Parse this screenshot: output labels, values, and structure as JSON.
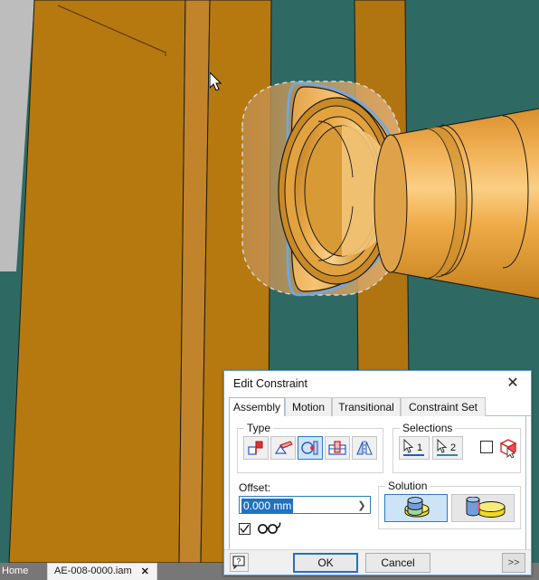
{
  "app": {
    "viewport": {
      "background_color": "#2e6a63",
      "part_color": "#b5790f",
      "shaft_color": "#e8a33a",
      "highlight_color": "#6fa8e8",
      "edge_color": "#1a1a1a",
      "cursor_name": "arrow-cursor"
    }
  },
  "taskbar": {
    "home_label": "Home",
    "document_tab": "AE-008-0000.iam",
    "close_glyph": "✕"
  },
  "dialog": {
    "title": "Edit Constraint",
    "close_glyph": "✕",
    "tabs": [
      {
        "label": "Assembly",
        "active": true
      },
      {
        "label": "Motion",
        "active": false
      },
      {
        "label": "Transitional",
        "active": false
      },
      {
        "label": "Constraint Set",
        "active": false
      }
    ],
    "type_group": {
      "label": "Type",
      "buttons": [
        {
          "name": "mate-constraint-icon",
          "selected": false
        },
        {
          "name": "angle-constraint-icon",
          "selected": false
        },
        {
          "name": "tangent-constraint-icon",
          "selected": true
        },
        {
          "name": "insert-constraint-icon",
          "selected": false
        },
        {
          "name": "symmetry-constraint-icon",
          "selected": false
        }
      ]
    },
    "selections_group": {
      "label": "Selections",
      "buttons": [
        {
          "name": "select-1-icon",
          "label": "1"
        },
        {
          "name": "select-2-icon",
          "label": "2"
        }
      ],
      "pick_part_first_checked": false,
      "show_all_constraints_icon": "cube-select-icon"
    },
    "offset": {
      "label": "Offset:",
      "value": "0.000 mm",
      "selected": true,
      "expand_glyph": "❯"
    },
    "predict": {
      "checked": true,
      "checkmark": "✓",
      "icon_name": "glasses-predict-icon"
    },
    "solution_group": {
      "label": "Solution",
      "options": [
        {
          "name": "solution-inside-icon",
          "selected": true
        },
        {
          "name": "solution-outside-icon",
          "selected": false
        }
      ]
    },
    "footer": {
      "help_glyph": "?",
      "ok_label": "OK",
      "cancel_label": "Cancel",
      "more_label": ">>"
    }
  }
}
